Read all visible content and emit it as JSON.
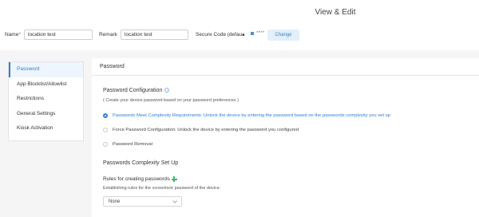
{
  "header": {
    "title": "View & Edit",
    "name_label": "Name",
    "name_required": "*",
    "name_value": "location test",
    "remark_label": "Remark",
    "remark_value": "location test",
    "secure_code_label": "Secure Code (defau",
    "secure_code_value": "****",
    "change_label": "Change"
  },
  "sidebar": {
    "items": [
      {
        "label": "Password",
        "active": true
      },
      {
        "label": "App Blocklist/Allowlist"
      },
      {
        "label": "Restrictions"
      },
      {
        "label": "General Settings"
      },
      {
        "label": "Kiosk Activation"
      }
    ]
  },
  "main": {
    "header": "Password",
    "config_title": "Password Configuration",
    "config_info": "i",
    "config_subtitle": "( Create your device password based on your password preferences )",
    "options": [
      {
        "label": "Passwords Meet Complexity Requirements: Unlock the device by entering the password based on the passwords complexity you set up",
        "checked": true
      },
      {
        "label": "Force Password Configuration: Unlock the device by entering the password you configured",
        "checked": false
      },
      {
        "label": "Password Removal",
        "checked": false
      }
    ],
    "complexity_title": "Passwords Complexity Set Up",
    "rules_title": "Rules for creating passwords",
    "rules_desc": "Establishing rules for the screenlock password of the device.",
    "rules_select_value": "None"
  },
  "colors": {
    "accent": "#2f7ed3",
    "required": "#e04040",
    "add_icon": "#3cb371"
  }
}
